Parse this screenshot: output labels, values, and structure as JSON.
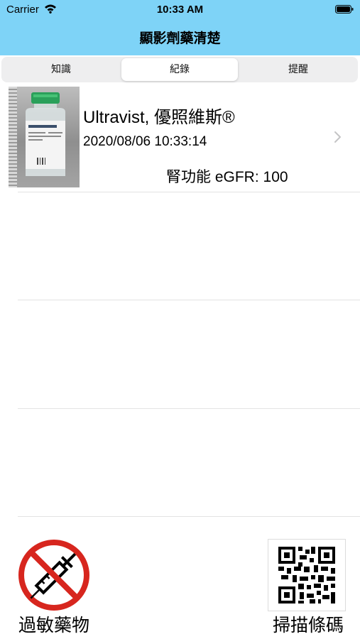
{
  "status_bar": {
    "carrier": "Carrier",
    "time": "10:33 AM"
  },
  "nav": {
    "title": "顯影劑藥清楚"
  },
  "tabs": [
    {
      "label": "知識",
      "selected": false
    },
    {
      "label": "紀錄",
      "selected": true
    },
    {
      "label": "提醒",
      "selected": false
    }
  ],
  "record": {
    "title": "Ultravist, 優照維斯®",
    "datetime": "2020/08/06 10:33:14",
    "egfr": "腎功能 eGFR: 100"
  },
  "bottom": {
    "allergy_label": "過敏藥物",
    "scan_label": "掃描條碼"
  },
  "colors": {
    "header_bg": "#7ed3f7",
    "prohibited_red": "#d7261e"
  },
  "icons": {
    "allergy": "no-syringe-icon",
    "scan": "qr-code-icon"
  }
}
